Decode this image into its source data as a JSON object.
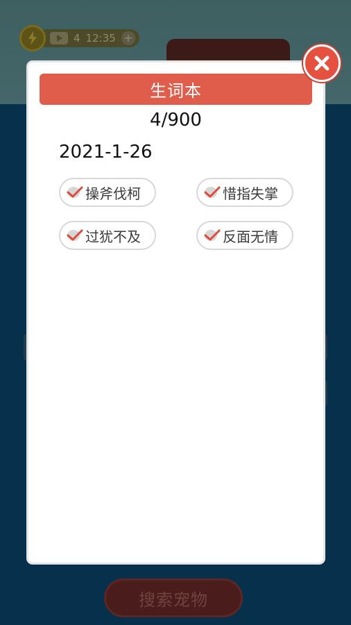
{
  "hud": {
    "video_count": "4",
    "timer": "12:35"
  },
  "game": {
    "search_pet_label": "搜索宠物"
  },
  "dialog": {
    "title": "生词本",
    "progress": "4/900",
    "date": "2021-1-26",
    "words": [
      {
        "text": "操斧伐柯",
        "checked": true
      },
      {
        "text": "惜指失掌",
        "checked": true
      },
      {
        "text": "过犹不及",
        "checked": true
      },
      {
        "text": "反面无情",
        "checked": true
      }
    ]
  },
  "colors": {
    "title_bar": "#e05c4b",
    "close_button": "#e5503f",
    "check_mark": "#e0493c"
  },
  "icons": [
    "energy-icon",
    "video-icon",
    "plus-icon",
    "close-icon",
    "check-icon"
  ]
}
